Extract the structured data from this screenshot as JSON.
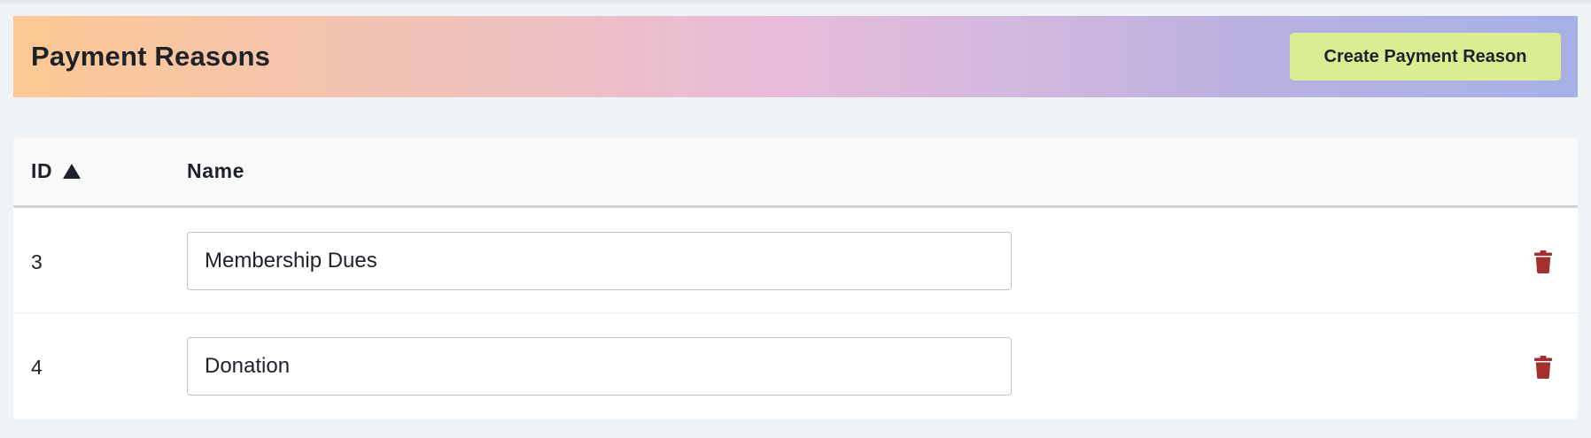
{
  "header": {
    "title": "Payment Reasons",
    "create_button_label": "Create Payment Reason",
    "create_button_color": "#d9ed92"
  },
  "table": {
    "columns": [
      {
        "label": "ID",
        "sort": "ascending",
        "sort_icon": "triangle-up-icon"
      },
      {
        "label": "Name"
      }
    ],
    "rows": [
      {
        "id": "3",
        "name": "Membership Dues",
        "action_icon": "trash-icon"
      },
      {
        "id": "4",
        "name": "Donation",
        "action_icon": "trash-icon"
      }
    ]
  },
  "colors": {
    "delete_icon": "#a3302f",
    "background": "#eff3f5"
  }
}
